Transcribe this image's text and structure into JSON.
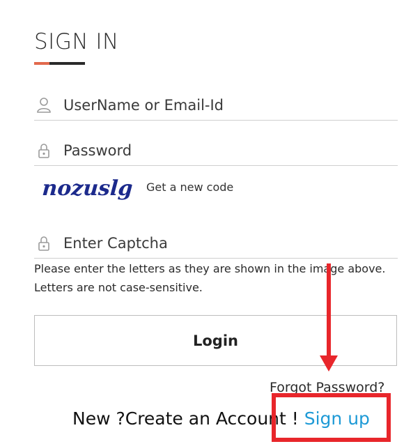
{
  "form": {
    "title": "SIGN IN",
    "username": {
      "placeholder": "UserName or Email-Id",
      "icon": "user-icon"
    },
    "password": {
      "placeholder": "Password",
      "icon": "lock-icon"
    },
    "captcha": {
      "image_text": "nozuslg",
      "refresh_label": "Get a new code",
      "placeholder": "Enter Captcha",
      "icon": "lock-icon",
      "hint_line1": "Please enter the letters as they are shown in the image above.",
      "hint_line2": "Letters are not case-sensitive."
    },
    "login_label": "Login",
    "forgot_label": "Forgot Password?",
    "signup_prompt": "New ?Create an Account ! ",
    "signup_label": "Sign up"
  },
  "colors": {
    "accent": "#e2694d",
    "link": "#1e9ad6",
    "annotation": "#e8262b",
    "captcha_text": "#1c2a8c"
  }
}
